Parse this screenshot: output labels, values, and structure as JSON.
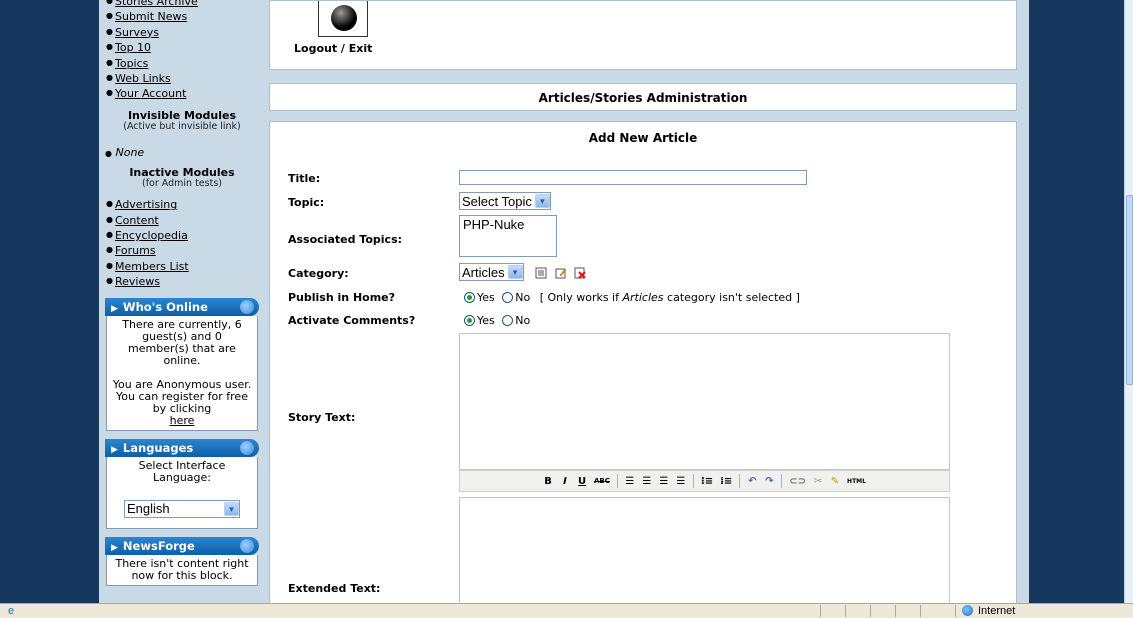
{
  "sidebar": {
    "top_modules": [
      "Stories Archive",
      "Submit News",
      "Surveys",
      "Top 10",
      "Topics",
      "Web Links",
      "Your Account"
    ],
    "invisible_title": "Invisible Modules",
    "invisible_sub": "(Active but invisible link)",
    "invisible_items": [
      "None"
    ],
    "inactive_title": "Inactive Modules",
    "inactive_sub": "(for Admin tests)",
    "inactive_items": [
      "Advertising",
      "Content",
      "Encyclopedia",
      "Forums",
      "Members List",
      "Reviews"
    ],
    "whos_online": {
      "title": "Who's Online",
      "text1": "There are currently, 6 guest(s) and 0 member(s) that are online.",
      "text2": "You are Anonymous user. You can register for free by clicking",
      "link": "here"
    },
    "languages": {
      "title": "Languages",
      "text": "Select Interface Language:",
      "selected": "English"
    },
    "newsforge": {
      "title": "NewsForge",
      "text": "There isn't content right now for this block."
    }
  },
  "main": {
    "logout_label": "Logout / Exit",
    "admin_title": "Articles/Stories Administration",
    "add_title": "Add New Article",
    "form": {
      "title_label": "Title:",
      "title_value": "",
      "topic_label": "Topic:",
      "topic_value": "Select Topic",
      "assoc_label": "Associated Topics:",
      "assoc_options": [
        "PHP-Nuke"
      ],
      "category_label": "Category:",
      "category_value": "Articles",
      "publish_label": "Publish in Home?",
      "yes": "Yes",
      "no": "No",
      "publish_note_pre": "[ Only works if ",
      "publish_note_em": "Articles",
      "publish_note_post": " category isn't selected ]",
      "comments_label": "Activate Comments?",
      "story_label": "Story Text:",
      "extended_label": "Extended Text:"
    },
    "toolbar": [
      "B",
      "I",
      "U",
      "ABC",
      "HTML"
    ]
  },
  "statusbar": {
    "zone": "Internet"
  },
  "colors": {
    "frame": "#16385f",
    "page_bg": "#c9d9e6",
    "block_title": "#0d5ea8",
    "radio_dot": "#21a121"
  }
}
